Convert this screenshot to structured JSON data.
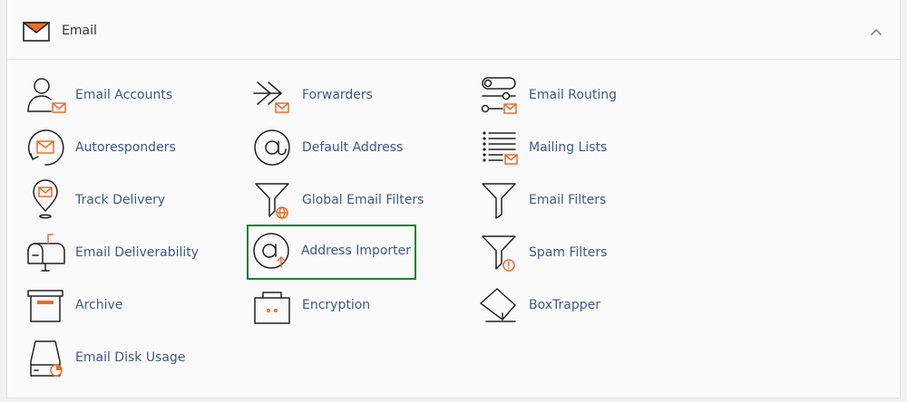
{
  "section": {
    "title": "Email",
    "icon": "envelope-icon",
    "collapse_icon": "chevron-up-icon"
  },
  "tools": [
    {
      "label": "Email Accounts",
      "icon": "email-accounts-icon"
    },
    {
      "label": "Forwarders",
      "icon": "forwarders-icon"
    },
    {
      "label": "Email Routing",
      "icon": "email-routing-icon"
    },
    {
      "label": "Autoresponders",
      "icon": "autoresponders-icon"
    },
    {
      "label": "Default Address",
      "icon": "default-address-icon"
    },
    {
      "label": "Mailing Lists",
      "icon": "mailing-lists-icon"
    },
    {
      "label": "Track Delivery",
      "icon": "track-delivery-icon"
    },
    {
      "label": "Global Email Filters",
      "icon": "global-email-filters-icon"
    },
    {
      "label": "Email Filters",
      "icon": "email-filters-icon"
    },
    {
      "label": "Email Deliverability",
      "icon": "email-deliverability-icon"
    },
    {
      "label": "Address Importer",
      "icon": "address-importer-icon",
      "highlighted": true
    },
    {
      "label": "Spam Filters",
      "icon": "spam-filters-icon"
    },
    {
      "label": "Archive",
      "icon": "archive-icon"
    },
    {
      "label": "Encryption",
      "icon": "encryption-icon"
    },
    {
      "label": "BoxTrapper",
      "icon": "boxtrapper-icon"
    },
    {
      "label": "Email Disk Usage",
      "icon": "email-disk-usage-icon"
    }
  ],
  "colors": {
    "link": "#3e5a88",
    "accent": "#ee6a2c",
    "highlight_border": "#1e7e34"
  }
}
